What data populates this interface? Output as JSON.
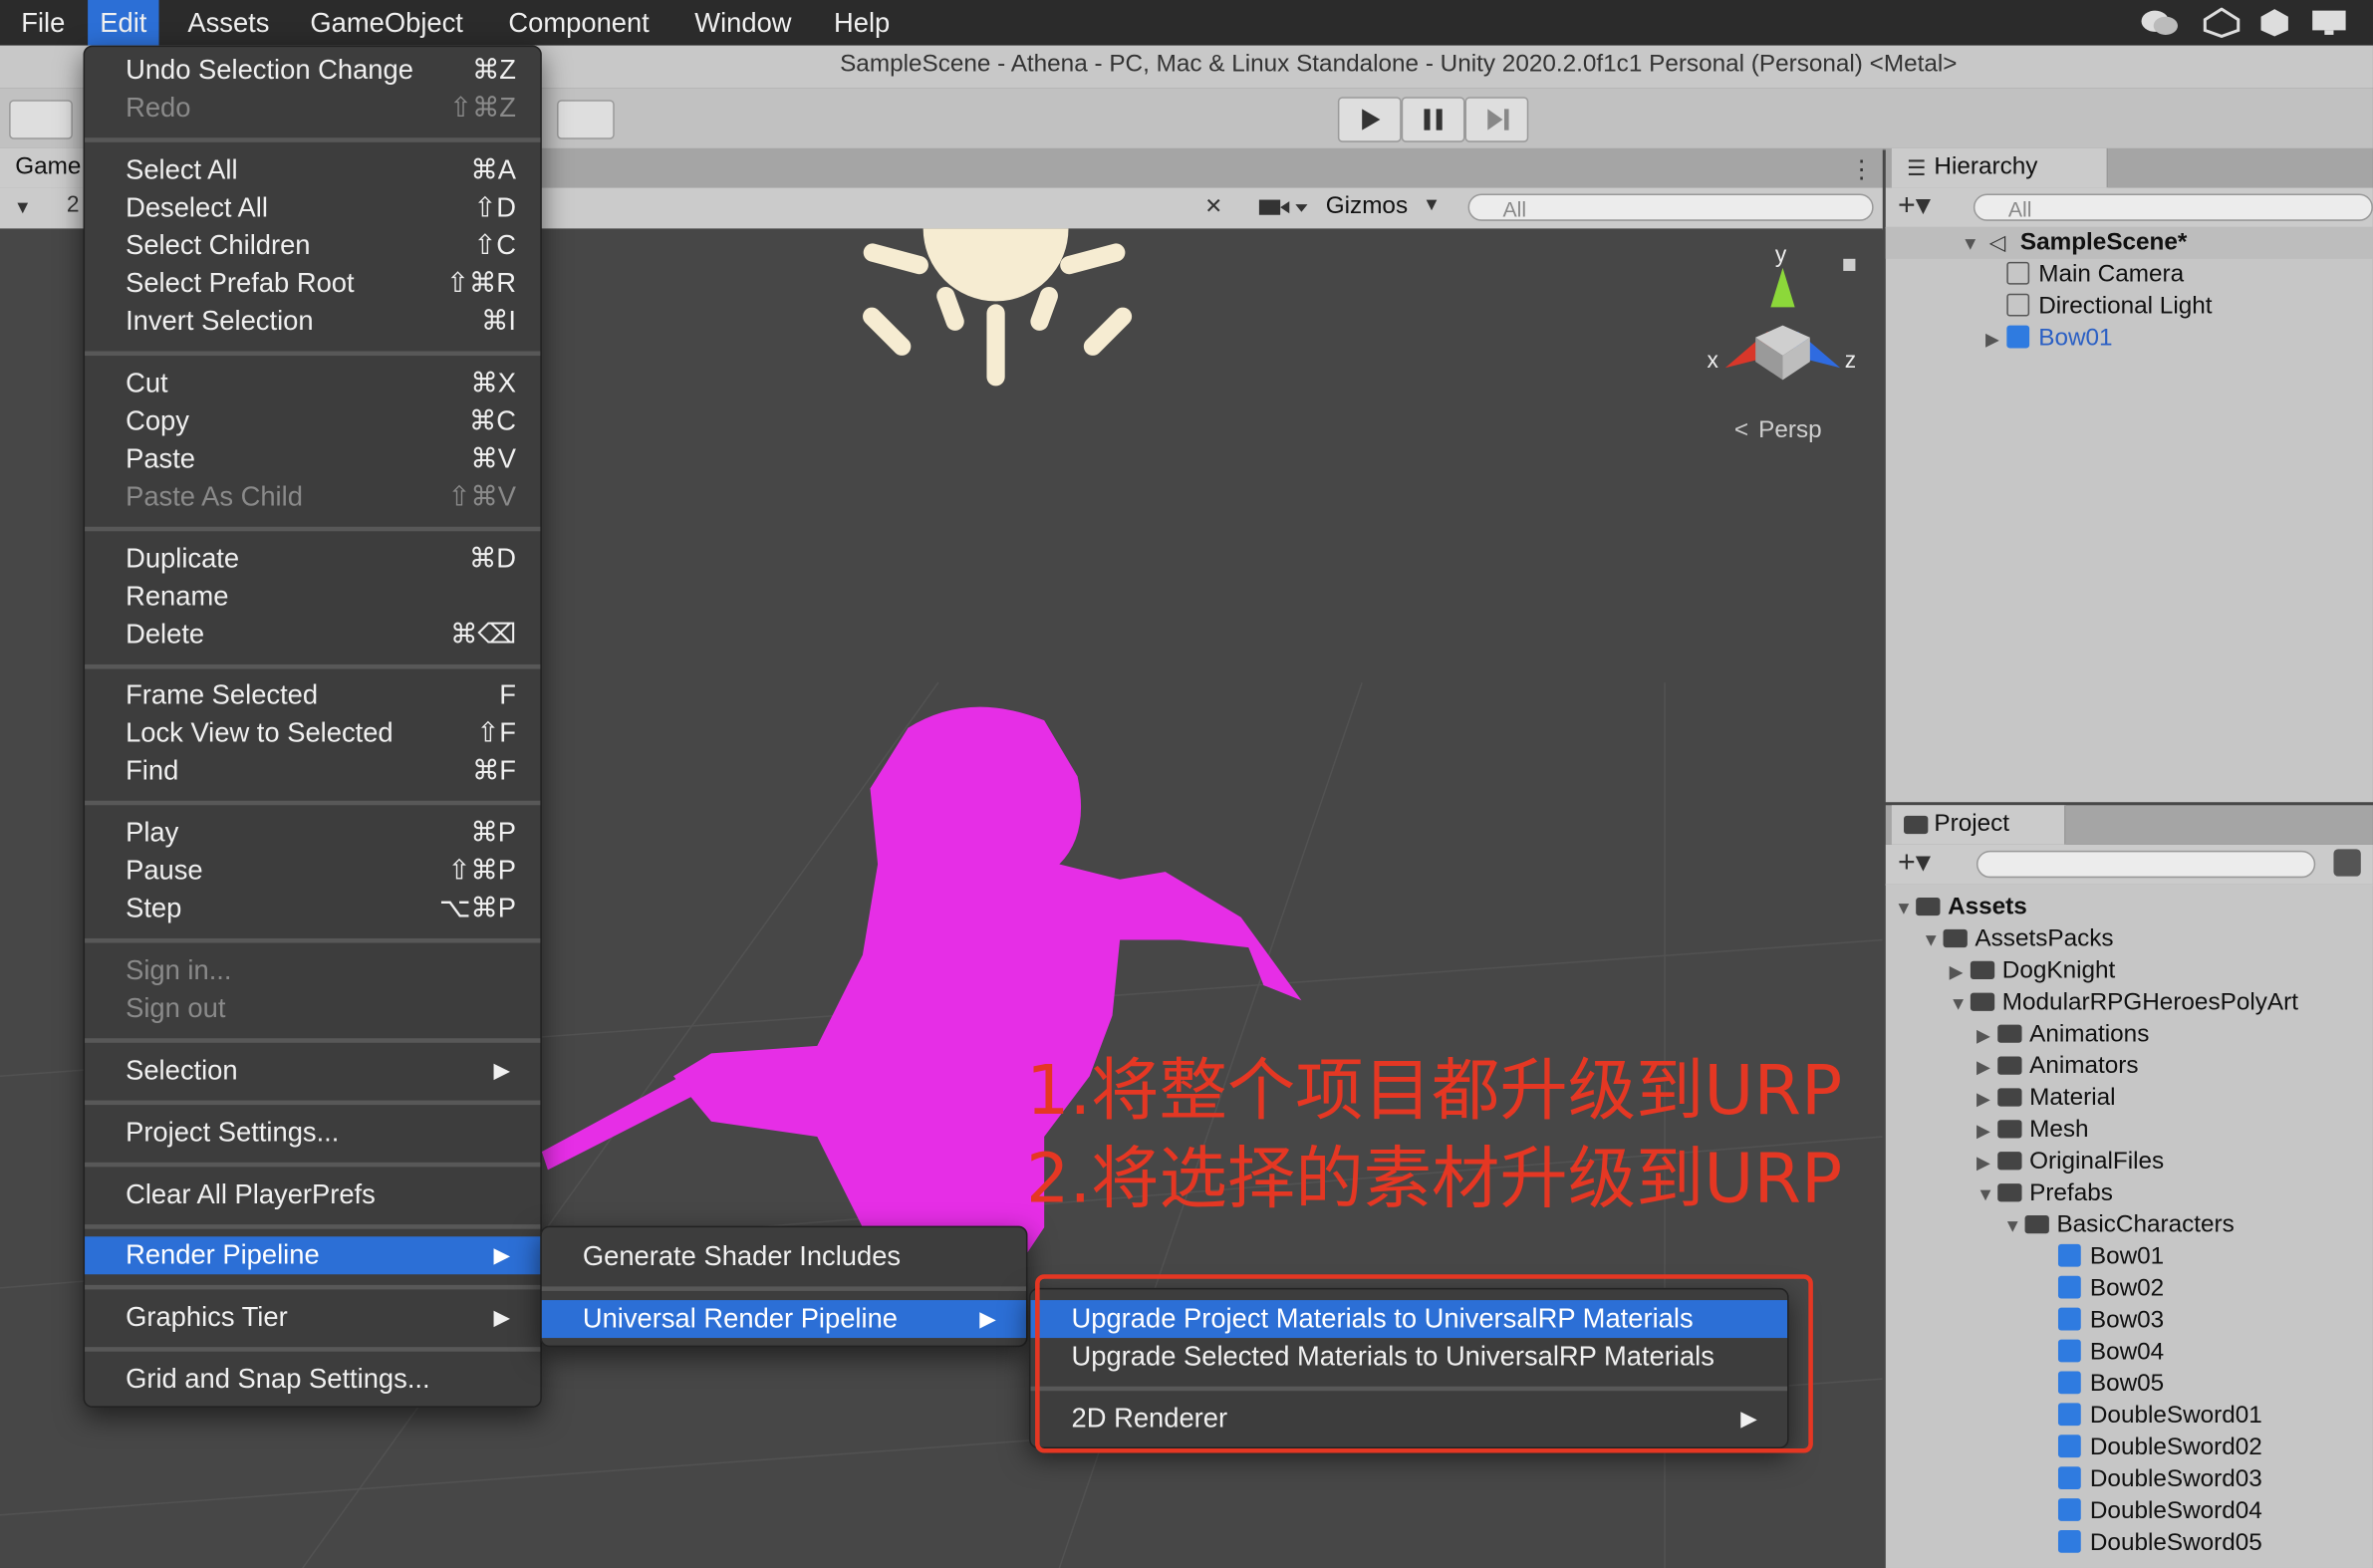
{
  "menubar": {
    "items": [
      "File",
      "Edit",
      "Assets",
      "GameObject",
      "Component",
      "Window",
      "Help"
    ],
    "active": "Edit"
  },
  "window_title": "SampleScene - Athena - PC, Mac & Linux Standalone - Unity 2020.2.0f1c1 Personal (Personal) <Metal>",
  "scene": {
    "left_tab_label": "Game",
    "left_tab_partial": "2",
    "gizmos_label": "Gizmos",
    "search_placeholder": "All",
    "persp_label": "Persp",
    "axis_labels": {
      "x": "x",
      "y": "y",
      "z": "z"
    }
  },
  "edit_menu": {
    "items": [
      {
        "label": "Undo Selection Change",
        "shortcut": "⌘Z",
        "disabled": false
      },
      {
        "label": "Redo",
        "shortcut": "⇧⌘Z",
        "disabled": true
      },
      {
        "label": "Select All",
        "shortcut": "⌘A",
        "disabled": false
      },
      {
        "label": "Deselect All",
        "shortcut": "⇧D",
        "disabled": false
      },
      {
        "label": "Select Children",
        "shortcut": "⇧C",
        "disabled": false
      },
      {
        "label": "Select Prefab Root",
        "shortcut": "⇧⌘R",
        "disabled": false
      },
      {
        "label": "Invert Selection",
        "shortcut": "⌘I",
        "disabled": false
      },
      {
        "label": "Cut",
        "shortcut": "⌘X",
        "disabled": false
      },
      {
        "label": "Copy",
        "shortcut": "⌘C",
        "disabled": false
      },
      {
        "label": "Paste",
        "shortcut": "⌘V",
        "disabled": false
      },
      {
        "label": "Paste As Child",
        "shortcut": "⇧⌘V",
        "disabled": true
      },
      {
        "label": "Duplicate",
        "shortcut": "⌘D",
        "disabled": false
      },
      {
        "label": "Rename",
        "shortcut": "",
        "disabled": false
      },
      {
        "label": "Delete",
        "shortcut": "⌘⌫",
        "disabled": false
      },
      {
        "label": "Frame Selected",
        "shortcut": "F",
        "disabled": false
      },
      {
        "label": "Lock View to Selected",
        "shortcut": "⇧F",
        "disabled": false
      },
      {
        "label": "Find",
        "shortcut": "⌘F",
        "disabled": false
      },
      {
        "label": "Play",
        "shortcut": "⌘P",
        "disabled": false
      },
      {
        "label": "Pause",
        "shortcut": "⇧⌘P",
        "disabled": false
      },
      {
        "label": "Step",
        "shortcut": "⌥⌘P",
        "disabled": false
      },
      {
        "label": "Sign in...",
        "shortcut": "",
        "disabled": true
      },
      {
        "label": "Sign out",
        "shortcut": "",
        "disabled": true
      },
      {
        "label": "Selection",
        "shortcut": "",
        "disabled": false,
        "submenu": true
      },
      {
        "label": "Project Settings...",
        "shortcut": "",
        "disabled": false
      },
      {
        "label": "Clear All PlayerPrefs",
        "shortcut": "",
        "disabled": false
      },
      {
        "label": "Render Pipeline",
        "shortcut": "",
        "disabled": false,
        "submenu": true,
        "highlighted": true
      },
      {
        "label": "Graphics Tier",
        "shortcut": "",
        "disabled": false,
        "submenu": true
      },
      {
        "label": "Grid and Snap Settings...",
        "shortcut": "",
        "disabled": false
      }
    ]
  },
  "render_pipeline_menu": {
    "items": [
      {
        "label": "Generate Shader Includes"
      },
      {
        "label": "Universal Render Pipeline",
        "submenu": true,
        "highlighted": true
      }
    ]
  },
  "urp_menu": {
    "items": [
      {
        "label": "Upgrade Project Materials to UniversalRP Materials",
        "highlighted": true
      },
      {
        "label": "Upgrade Selected Materials to UniversalRP Materials"
      },
      {
        "label": "2D Renderer",
        "submenu": true
      }
    ]
  },
  "annotations": {
    "line1": "1.将整个项目都升级到URP",
    "line2": "2.将选择的素材升级到URP",
    "color": "#e53723"
  },
  "hierarchy": {
    "tab_label": "Hierarchy",
    "search_placeholder": "All",
    "rows": [
      {
        "label": "SampleScene*",
        "indent": 0,
        "expanded": true,
        "kind": "scene"
      },
      {
        "label": "Main Camera",
        "indent": 1,
        "kind": "object"
      },
      {
        "label": "Directional Light",
        "indent": 1,
        "kind": "object"
      },
      {
        "label": "Bow01",
        "indent": 1,
        "kind": "prefab",
        "collapsed": true
      }
    ]
  },
  "project": {
    "tab_label": "Project",
    "tree": [
      {
        "label": "Assets",
        "indent": 0,
        "expanded": true,
        "kind": "folder-open"
      },
      {
        "label": "AssetsPacks",
        "indent": 1,
        "expanded": true,
        "kind": "folder-open"
      },
      {
        "label": "DogKnight",
        "indent": 2,
        "collapsed": true,
        "kind": "folder"
      },
      {
        "label": "ModularRPGHeroesPolyArt",
        "indent": 2,
        "expanded": true,
        "kind": "folder-open"
      },
      {
        "label": "Animations",
        "indent": 3,
        "collapsed": true,
        "kind": "folder"
      },
      {
        "label": "Animators",
        "indent": 3,
        "collapsed": true,
        "kind": "folder"
      },
      {
        "label": "Material",
        "indent": 3,
        "collapsed": true,
        "kind": "folder"
      },
      {
        "label": "Mesh",
        "indent": 3,
        "collapsed": true,
        "kind": "folder"
      },
      {
        "label": "OriginalFiles",
        "indent": 3,
        "collapsed": true,
        "kind": "folder"
      },
      {
        "label": "Prefabs",
        "indent": 3,
        "expanded": true,
        "kind": "folder-open"
      },
      {
        "label": "BasicCharacters",
        "indent": 4,
        "expanded": true,
        "kind": "folder-open"
      },
      {
        "label": "Bow01",
        "indent": 5,
        "kind": "prefab"
      },
      {
        "label": "Bow02",
        "indent": 5,
        "kind": "prefab"
      },
      {
        "label": "Bow03",
        "indent": 5,
        "kind": "prefab"
      },
      {
        "label": "Bow04",
        "indent": 5,
        "kind": "prefab"
      },
      {
        "label": "Bow05",
        "indent": 5,
        "kind": "prefab"
      },
      {
        "label": "DoubleSword01",
        "indent": 5,
        "kind": "prefab"
      },
      {
        "label": "DoubleSword02",
        "indent": 5,
        "kind": "prefab"
      },
      {
        "label": "DoubleSword03",
        "indent": 5,
        "kind": "prefab"
      },
      {
        "label": "DoubleSword04",
        "indent": 5,
        "kind": "prefab"
      },
      {
        "label": "DoubleSword05",
        "indent": 5,
        "kind": "prefab"
      }
    ]
  },
  "colors": {
    "menu_bg": "#3d3d3d",
    "highlight": "#2c6fd6",
    "character_magenta": "#e62ee6",
    "prefab_blue": "#2f7be0",
    "sun_color": "#f6ecd2"
  }
}
